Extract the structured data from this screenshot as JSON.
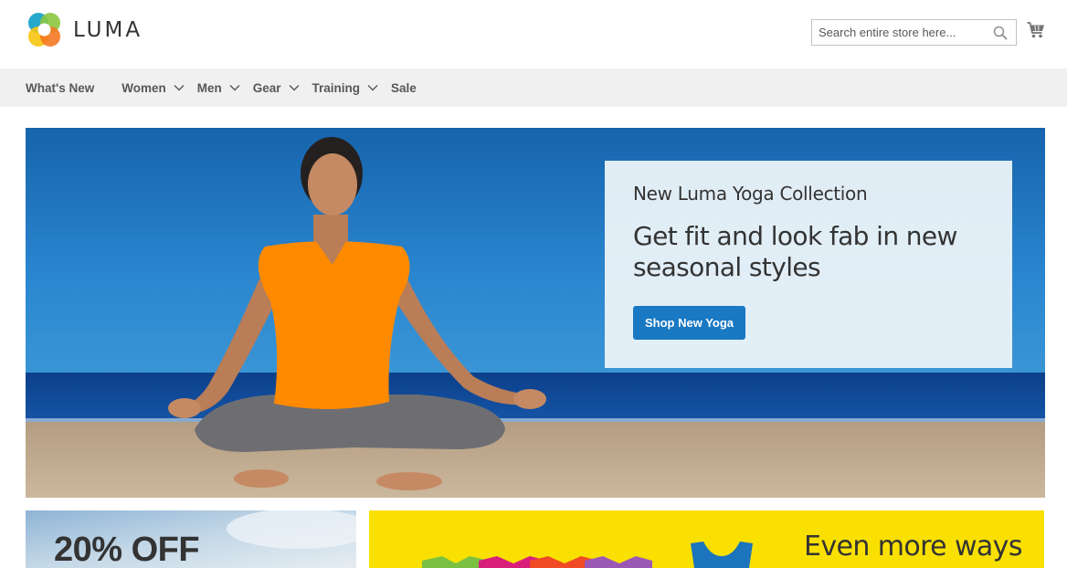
{
  "brand": {
    "name": "LUMA",
    "logo_icon": "luma-logo-icon"
  },
  "search": {
    "placeholder": "Search entire store here...",
    "icon": "search-icon"
  },
  "cart": {
    "icon": "shopping-cart-icon"
  },
  "nav": {
    "items": [
      {
        "label": "What's New",
        "has_submenu": false
      },
      {
        "label": "Women",
        "has_submenu": true
      },
      {
        "label": "Men",
        "has_submenu": true
      },
      {
        "label": "Gear",
        "has_submenu": true
      },
      {
        "label": "Training",
        "has_submenu": true
      },
      {
        "label": "Sale",
        "has_submenu": false
      }
    ]
  },
  "hero": {
    "kicker": "New Luma Yoga Collection",
    "title": "Get fit and look fab in new seasonal styles",
    "button_label": "Shop New Yoga"
  },
  "promos": {
    "left_text": "20% OFF",
    "right_text": "Even more ways"
  },
  "colors": {
    "accent": "#1979c3",
    "nav_bg": "#f0f0f0",
    "promo_yellow": "#f9e000",
    "sky_blue": "#1c6fb8",
    "shirt_orange": "#ff8a00"
  }
}
